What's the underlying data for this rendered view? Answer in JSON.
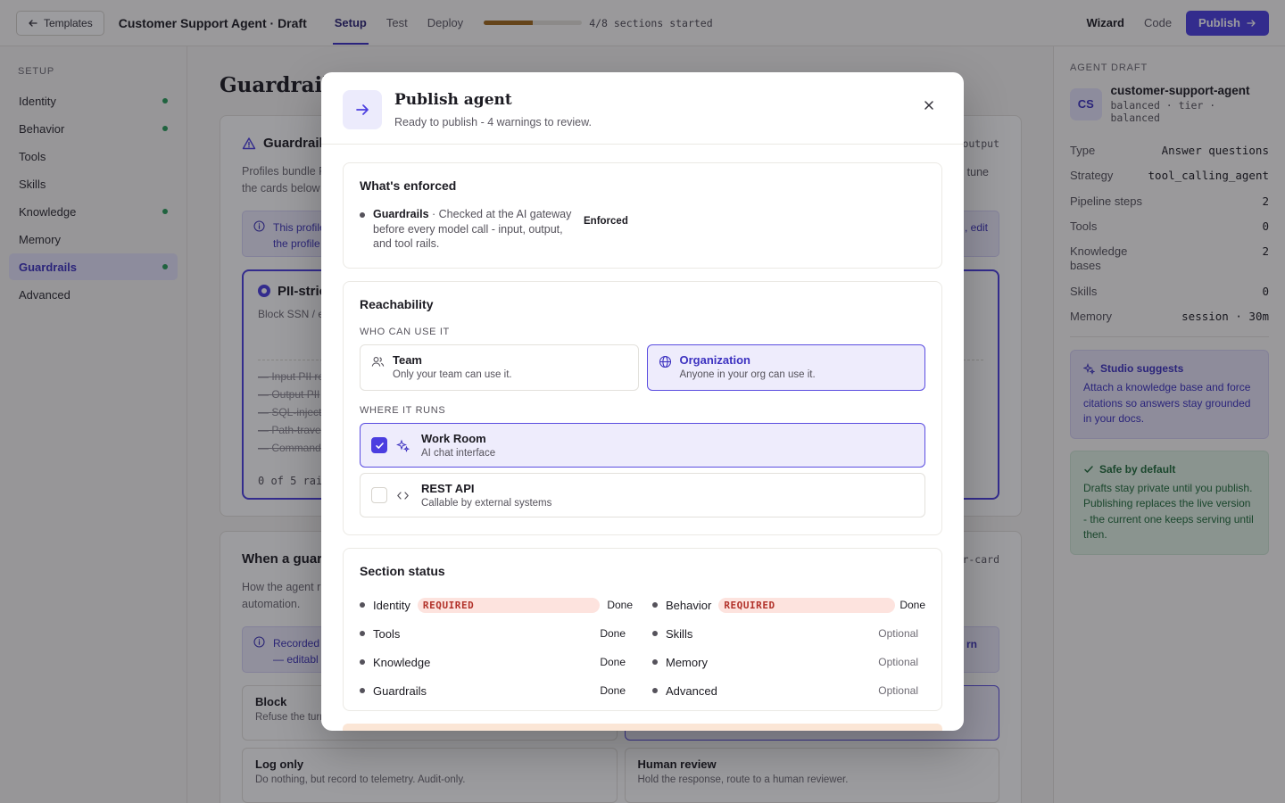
{
  "topbar": {
    "back_label": "Templates",
    "title": "Customer Support Agent · Draft",
    "tabs": [
      {
        "label": "Setup",
        "active": true
      },
      {
        "label": "Test",
        "active": false
      },
      {
        "label": "Deploy",
        "active": false
      }
    ],
    "progress_fraction": 0.5,
    "progress_text": "4/8 sections started",
    "modes": [
      "Wizard",
      "Code"
    ],
    "publish_label": "Publish"
  },
  "sidebar": {
    "heading": "SETUP",
    "items": [
      {
        "label": "Identity",
        "done": true
      },
      {
        "label": "Behavior",
        "done": true
      },
      {
        "label": "Tools",
        "done": false
      },
      {
        "label": "Skills",
        "done": false
      },
      {
        "label": "Knowledge",
        "done": true
      },
      {
        "label": "Memory",
        "done": false
      },
      {
        "label": "Guardrails",
        "done": true,
        "active": true
      },
      {
        "label": "Advanced",
        "done": false
      }
    ]
  },
  "main": {
    "title": "Guardrails",
    "card1": {
      "title": "Guardrail",
      "side_tag": "output",
      "desc_line1": "Profiles bundle P",
      "desc_line2": "the cards below",
      "desc_tail": "tune",
      "info_line1": "This profile",
      "info_line2": "the profile",
      "info_tail": ", edit",
      "profile_title": "PII-stric",
      "profile_desc": "Block SSN / er",
      "rails": [
        "Input PII re",
        "Output PII",
        "SQL-inject",
        "Path-trave",
        "Command"
      ],
      "rails_count": "0 of 5 rail"
    },
    "card2": {
      "title": "When a guard",
      "side_tag": "r-card",
      "desc_line1": "How the agent r",
      "desc_line2": "automation.",
      "info_line1": "Recorded",
      "info_line2": "— editabl",
      "info_tail": "rn",
      "options": [
        {
          "title": "Block",
          "sub": "Refuse the turn"
        },
        {
          "title": "Log only",
          "sub": "Do nothing, but record to telemetry. Audit-only."
        },
        {
          "title": "Human review",
          "sub": "Hold the response, route to a human reviewer."
        }
      ]
    }
  },
  "rpanel": {
    "heading": "AGENT DRAFT",
    "avatar": "CS",
    "name": "customer-support-agent",
    "sub": "balanced · tier · balanced",
    "rows": [
      {
        "key": "Type",
        "value": "Answer questions"
      },
      {
        "key": "Strategy",
        "value": "tool_calling_agent"
      },
      {
        "key": "Pipeline steps",
        "value": "2"
      },
      {
        "key": "Tools",
        "value": "0"
      },
      {
        "key": "Knowledge bases",
        "value": "2"
      },
      {
        "key": "Skills",
        "value": "0"
      },
      {
        "key": "Memory",
        "value": "session · 30m"
      }
    ],
    "suggest_title": "Studio suggests",
    "suggest_body": "Attach a knowledge base and force citations so answers stay grounded in your docs.",
    "safe_title": "Safe by default",
    "safe_body": "Drafts stay private until you publish. Publishing replaces the live version - the current one keeps serving until then."
  },
  "modal": {
    "title": "Publish agent",
    "subtitle": "Ready to publish - 4 warnings to review.",
    "enforced": {
      "title": "What's enforced",
      "item_name": "Guardrails",
      "item_desc": " · Checked at the AI gateway before every model call - input, output, and tool rails.",
      "badge": "Enforced"
    },
    "reach": {
      "title": "Reachability",
      "who_label": "WHO CAN USE IT",
      "who_options": [
        {
          "title": "Team",
          "sub": "Only your team can use it.",
          "selected": false
        },
        {
          "title": "Organization",
          "sub": "Anyone in your org can use it.",
          "selected": true
        }
      ],
      "where_label": "WHERE IT RUNS",
      "where_options": [
        {
          "title": "Work Room",
          "sub": "AI chat interface",
          "checked": true
        },
        {
          "title": "REST API",
          "sub": "Callable by external systems",
          "checked": false
        }
      ]
    },
    "status": {
      "title": "Section status",
      "required_label": "REQUIRED",
      "left": [
        {
          "name": "Identity",
          "required": true,
          "value": "Done"
        },
        {
          "name": "Tools",
          "required": false,
          "value": "Done"
        },
        {
          "name": "Knowledge",
          "required": false,
          "value": "Done"
        },
        {
          "name": "Guardrails",
          "required": false,
          "value": "Done"
        }
      ],
      "right": [
        {
          "name": "Behavior",
          "required": true,
          "value": "Done"
        },
        {
          "name": "Skills",
          "required": false,
          "value": "Optional"
        },
        {
          "name": "Memory",
          "required": false,
          "value": "Optional"
        },
        {
          "name": "Advanced",
          "required": false,
          "value": "Optional"
        }
      ]
    }
  },
  "colors": {
    "accent": "#4b3ee0",
    "progress": "#a0681a",
    "done_dot": "#2a9d5a",
    "required_bg": "#fde3de",
    "required_text": "#b2322a"
  }
}
